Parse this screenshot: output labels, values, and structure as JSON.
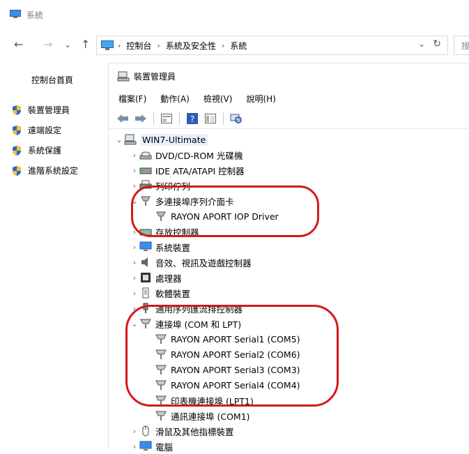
{
  "window": {
    "title": "系統"
  },
  "address_bar": {
    "nav": {
      "back": "←",
      "forward": "→",
      "recent": "⌄",
      "up": "↑"
    },
    "breadcrumbs": [
      "控制台",
      "系統及安全性",
      "系統"
    ],
    "separator": "›",
    "dropdown": "⌄",
    "refresh": "↻",
    "search_glyph": "搜"
  },
  "sidebar": {
    "home": "控制台首頁",
    "items": [
      {
        "label": "裝置管理員",
        "icon": "shield-icon"
      },
      {
        "label": "遠端設定",
        "icon": "shield-icon"
      },
      {
        "label": "系統保護",
        "icon": "shield-icon"
      },
      {
        "label": "進階系統設定",
        "icon": "shield-icon"
      }
    ]
  },
  "device_manager": {
    "title": "裝置管理員",
    "menu": [
      "檔案(F)",
      "動作(A)",
      "檢視(V)",
      "說明(H)"
    ],
    "toolbar": [
      "back-icon",
      "forward-icon",
      "properties-icon",
      "help-icon",
      "view-icon",
      "scan-icon"
    ],
    "tree": [
      {
        "level": 0,
        "arrow": "⌄",
        "label": "WIN7-Ultimate",
        "icon": "computer-icon"
      },
      {
        "level": 1,
        "arrow": "›",
        "label": "DVD/CD-ROM 光碟機",
        "icon": "dvd-drive-icon"
      },
      {
        "level": 1,
        "arrow": "›",
        "label": "IDE ATA/ATAPI 控制器",
        "icon": "ide-controller-icon"
      },
      {
        "level": 1,
        "arrow": "›",
        "label": "列印佇列",
        "icon": "printer-icon"
      },
      {
        "level": 1,
        "arrow": "⌄",
        "label": "多連接埠序列介面卡",
        "icon": "multiport-serial-icon"
      },
      {
        "level": 2,
        "arrow": "",
        "label": "RAYON APORT IOP Driver",
        "icon": "serial-device-icon"
      },
      {
        "level": 1,
        "arrow": "›",
        "label": "存放控制器",
        "icon": "storage-icon"
      },
      {
        "level": 1,
        "arrow": "›",
        "label": "系統裝置",
        "icon": "monitor-icon"
      },
      {
        "level": 1,
        "arrow": "›",
        "label": "音效、視訊及遊戲控制器",
        "icon": "speaker-icon"
      },
      {
        "level": 1,
        "arrow": "›",
        "label": "處理器",
        "icon": "processor-icon"
      },
      {
        "level": 1,
        "arrow": "›",
        "label": "軟體裝置",
        "icon": "software-device-icon"
      },
      {
        "level": 1,
        "arrow": "›",
        "label": "通用序列匯流排控制器",
        "icon": "usb-icon"
      },
      {
        "level": 1,
        "arrow": "⌄",
        "label": "連接埠 (COM 和 LPT)",
        "icon": "port-icon"
      },
      {
        "level": 2,
        "arrow": "",
        "label": "RAYON APORT Serial1 (COM5)",
        "icon": "port-icon"
      },
      {
        "level": 2,
        "arrow": "",
        "label": "RAYON APORT Serial2 (COM6)",
        "icon": "port-icon"
      },
      {
        "level": 2,
        "arrow": "",
        "label": "RAYON APORT Serial3 (COM3)",
        "icon": "port-icon"
      },
      {
        "level": 2,
        "arrow": "",
        "label": "RAYON APORT Serial4 (COM4)",
        "icon": "port-icon"
      },
      {
        "level": 2,
        "arrow": "",
        "label": "印表機連接埠 (LPT1)",
        "icon": "port-icon"
      },
      {
        "level": 2,
        "arrow": "",
        "label": "通訊連接埠 (COM1)",
        "icon": "port-icon"
      },
      {
        "level": 1,
        "arrow": "›",
        "label": "滑鼠及其他指標裝置",
        "icon": "mouse-icon"
      },
      {
        "level": 1,
        "arrow": "›",
        "label": "電腦",
        "icon": "monitor-icon"
      }
    ]
  },
  "colors": {
    "annotation": "#d21a1a",
    "selection": "#e8f2fe"
  }
}
